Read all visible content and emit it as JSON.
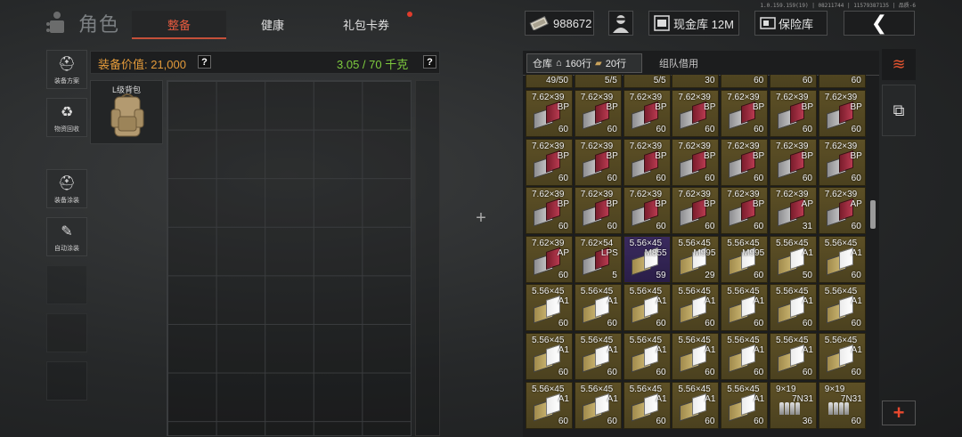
{
  "version": "1.0.159.159(19) | 08211744 | 11579387135 | 品质-6",
  "title": "角色",
  "tabs": {
    "equip": "整备",
    "health": "健康",
    "gift": "礼包卡券"
  },
  "top": {
    "money": "988672",
    "cash_vault": "现金库 12M",
    "safe": "保险库",
    "back": "❮"
  },
  "sidebar": {
    "loadout": "装备方案",
    "recycle": "物资回收",
    "paint": "装备涂装",
    "auto_paint": "自动涂装"
  },
  "equipment": {
    "value_label": "装备价值: 21,000",
    "weight": "3.05 / 70 千克",
    "help": "?",
    "backpack_label": "L级背包"
  },
  "warehouse": {
    "tab_label": "仓库",
    "rows_a": "160行",
    "rows_b": "20行",
    "team_tab": "组队借用",
    "top_row": [
      {
        "cnt": "49/50"
      },
      {
        "cnt": "5/5"
      },
      {
        "cnt": "5/5"
      },
      {
        "cnt": "30"
      },
      {
        "cnt": "60"
      },
      {
        "cnt": "60"
      },
      {
        "cnt": "60"
      }
    ],
    "rows": [
      [
        {
          "cal": "7.62×39",
          "typ": "BP",
          "cnt": "60"
        },
        {
          "cal": "7.62×39",
          "typ": "BP",
          "cnt": "60"
        },
        {
          "cal": "7.62×39",
          "typ": "BP",
          "cnt": "60"
        },
        {
          "cal": "7.62×39",
          "typ": "BP",
          "cnt": "60"
        },
        {
          "cal": "7.62×39",
          "typ": "BP",
          "cnt": "60"
        },
        {
          "cal": "7.62×39",
          "typ": "BP",
          "cnt": "60"
        },
        {
          "cal": "7.62×39",
          "typ": "BP",
          "cnt": "60"
        }
      ],
      [
        {
          "cal": "7.62×39",
          "typ": "BP",
          "cnt": "60"
        },
        {
          "cal": "7.62×39",
          "typ": "BP",
          "cnt": "60"
        },
        {
          "cal": "7.62×39",
          "typ": "BP",
          "cnt": "60"
        },
        {
          "cal": "7.62×39",
          "typ": "BP",
          "cnt": "60"
        },
        {
          "cal": "7.62×39",
          "typ": "BP",
          "cnt": "60"
        },
        {
          "cal": "7.62×39",
          "typ": "BP",
          "cnt": "60"
        },
        {
          "cal": "7.62×39",
          "typ": "BP",
          "cnt": "60"
        }
      ],
      [
        {
          "cal": "7.62×39",
          "typ": "BP",
          "cnt": "60"
        },
        {
          "cal": "7.62×39",
          "typ": "BP",
          "cnt": "60"
        },
        {
          "cal": "7.62×39",
          "typ": "BP",
          "cnt": "60"
        },
        {
          "cal": "7.62×39",
          "typ": "BP",
          "cnt": "60"
        },
        {
          "cal": "7.62×39",
          "typ": "BP",
          "cnt": "60"
        },
        {
          "cal": "7.62×39",
          "typ": "AP",
          "cnt": "31"
        },
        {
          "cal": "7.62×39",
          "typ": "AP",
          "cnt": "60"
        }
      ],
      [
        {
          "cal": "7.62×39",
          "typ": "AP",
          "cnt": "60"
        },
        {
          "cal": "7.62×54",
          "typ": "LPS",
          "cnt": "5"
        },
        {
          "cal": "5.56×45",
          "typ": "M855",
          "cnt": "59",
          "purple": true
        },
        {
          "cal": "5.56×45",
          "typ": "M995",
          "cnt": "29"
        },
        {
          "cal": "5.56×45",
          "typ": "M995",
          "cnt": "60"
        },
        {
          "cal": "5.56×45",
          "typ": "A1",
          "cnt": "50"
        },
        {
          "cal": "5.56×45",
          "typ": "A1",
          "cnt": "60"
        }
      ],
      [
        {
          "cal": "5.56×45",
          "typ": "A1",
          "cnt": "60"
        },
        {
          "cal": "5.56×45",
          "typ": "A1",
          "cnt": "60"
        },
        {
          "cal": "5.56×45",
          "typ": "A1",
          "cnt": "60"
        },
        {
          "cal": "5.56×45",
          "typ": "A1",
          "cnt": "60"
        },
        {
          "cal": "5.56×45",
          "typ": "A1",
          "cnt": "60"
        },
        {
          "cal": "5.56×45",
          "typ": "A1",
          "cnt": "60"
        },
        {
          "cal": "5.56×45",
          "typ": "A1",
          "cnt": "60"
        }
      ],
      [
        {
          "cal": "5.56×45",
          "typ": "A1",
          "cnt": "60"
        },
        {
          "cal": "5.56×45",
          "typ": "A1",
          "cnt": "60"
        },
        {
          "cal": "5.56×45",
          "typ": "A1",
          "cnt": "60"
        },
        {
          "cal": "5.56×45",
          "typ": "A1",
          "cnt": "60"
        },
        {
          "cal": "5.56×45",
          "typ": "A1",
          "cnt": "60"
        },
        {
          "cal": "5.56×45",
          "typ": "A1",
          "cnt": "60"
        },
        {
          "cal": "5.56×45",
          "typ": "A1",
          "cnt": "60"
        }
      ],
      [
        {
          "cal": "5.56×45",
          "typ": "A1",
          "cnt": "60"
        },
        {
          "cal": "5.56×45",
          "typ": "A1",
          "cnt": "60"
        },
        {
          "cal": "5.56×45",
          "typ": "A1",
          "cnt": "60"
        },
        {
          "cal": "5.56×45",
          "typ": "A1",
          "cnt": "60"
        },
        {
          "cal": "5.56×45",
          "typ": "A1",
          "cnt": "60"
        },
        {
          "cal": "9×19",
          "typ": "7N31",
          "cnt": "36"
        },
        {
          "cal": "9×19",
          "typ": "7N31",
          "cnt": "60"
        }
      ]
    ]
  },
  "right": {
    "add": "+"
  },
  "colors": {
    "accent": "#e45a3f",
    "value": "#e39a3a",
    "weight": "#7ecb3e",
    "cell": "#5d5026"
  }
}
